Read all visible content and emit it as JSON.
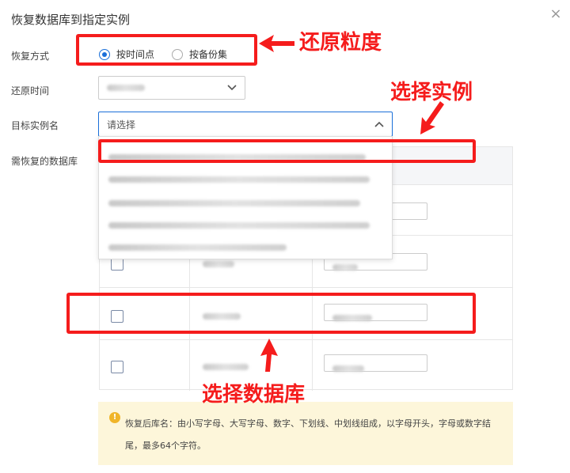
{
  "dialog": {
    "title": "恢复数据库到指定实例",
    "close_label": "×"
  },
  "form": {
    "restore_mode_label": "恢复方式",
    "restore_mode_options": [
      "按时间点",
      "按备份集"
    ],
    "restore_time_label": "还原时间",
    "target_instance_label": "目标实例名",
    "target_instance_placeholder": "请选择",
    "databases_label": "需恢复的数据库"
  },
  "notice": {
    "icon": "warning-icon",
    "text": "恢复后库名：由小写字母、大写字母、数字、下划线、中划线组成，以字母开头，字母或数字结尾，最多64个字符。"
  },
  "annotations": {
    "restore_granularity": "还原粒度",
    "select_instance": "选择实例",
    "select_database": "选择数据库"
  },
  "colors": {
    "accent": "#1a6fd9",
    "annotation": "#f51c1c",
    "notice_bg": "#fdf6da",
    "warning": "#f0b52a"
  }
}
